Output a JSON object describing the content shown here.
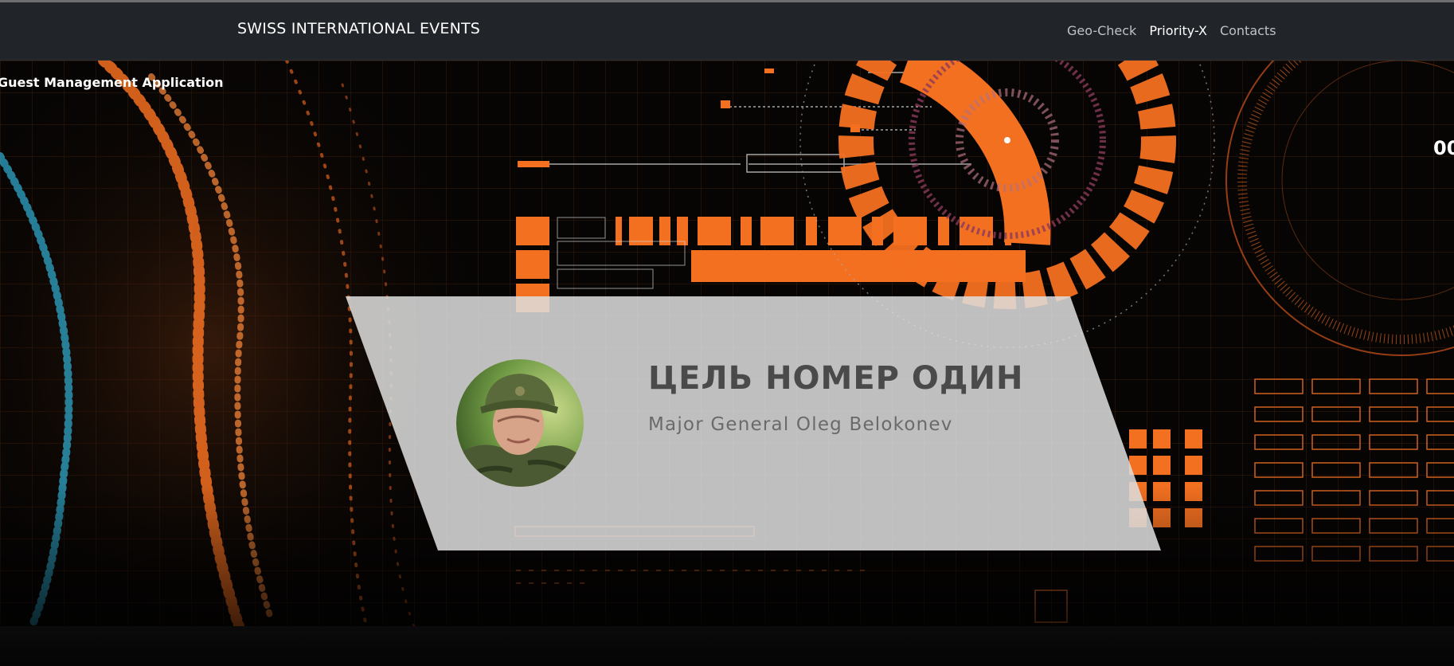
{
  "navbar": {
    "brand": "SWISS INTERNATIONAL EVENTS",
    "links": [
      {
        "label": "Geo-Check",
        "active": false
      },
      {
        "label": "Priority-X",
        "active": true
      },
      {
        "label": "Contacts",
        "active": false
      }
    ]
  },
  "hero": {
    "app_title": "Guest Management Application",
    "hud_readout": "00"
  },
  "card": {
    "title": "ЦЕЛЬ НОМЕР ОДИН",
    "name": "Major General Oleg Belokonev"
  },
  "colors": {
    "accent_orange": "#f37021",
    "navbar_bg": "#212529",
    "card_bg": "#dedede"
  }
}
